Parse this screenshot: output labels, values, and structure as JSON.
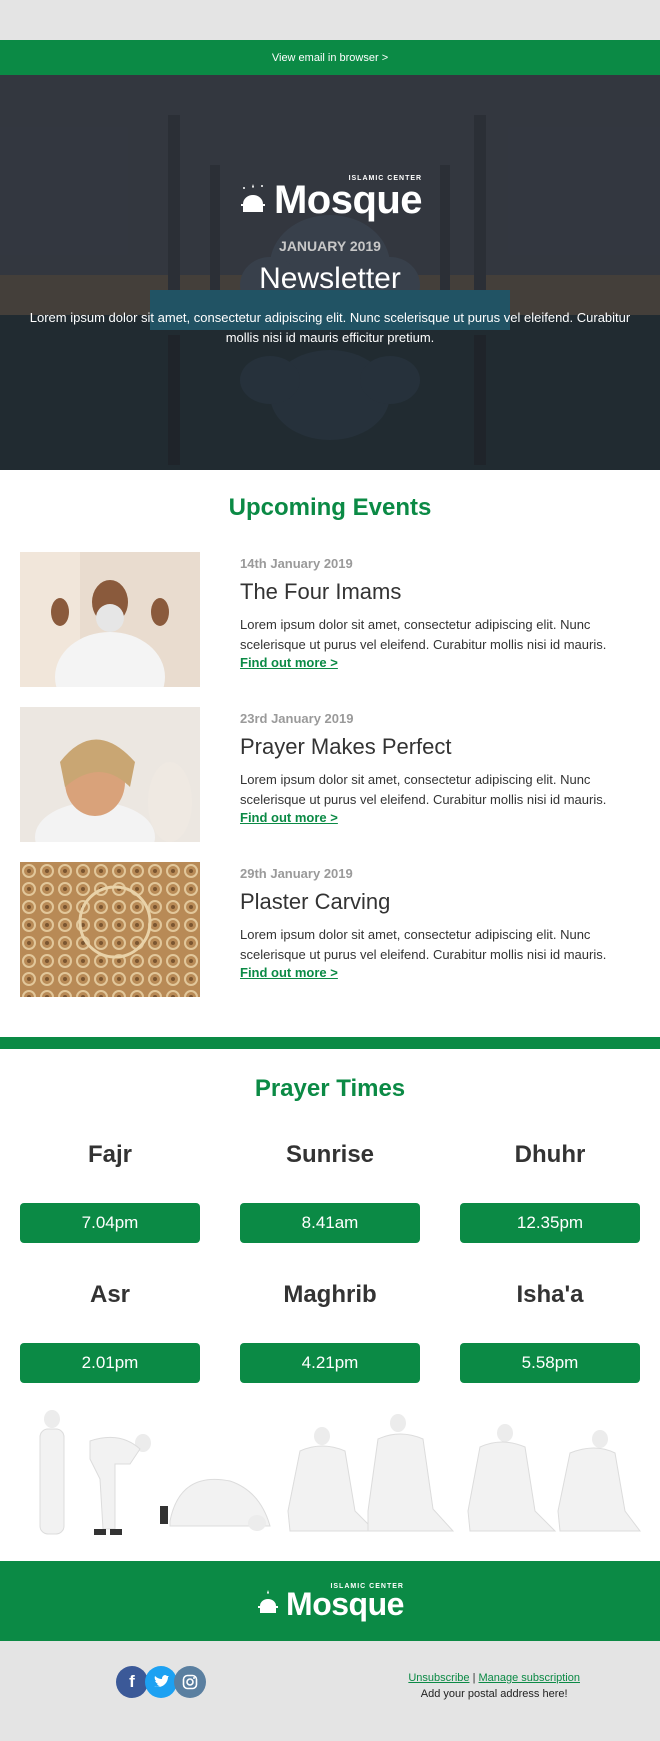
{
  "browser_bar": {
    "label": "View email in browser >"
  },
  "hero": {
    "logo_small": "ISLAMIC CENTER",
    "logo_big": "Mosque",
    "date": "JANUARY 2019",
    "title": "Newsletter",
    "text": "Lorem ipsum dolor sit amet, consectetur adipiscing elit. Nunc scelerisque ut purus vel eleifend. Curabitur mollis nisi id mauris efficitur pretium."
  },
  "events": {
    "title": "Upcoming Events",
    "items": [
      {
        "date": "14th January 2019",
        "title": "The Four Imams",
        "desc": "Lorem ipsum dolor sit amet, consectetur adipiscing elit. Nunc scelerisque ut purus vel eleifend. Curabitur mollis nisi id mauris.",
        "link": "Find out more >"
      },
      {
        "date": "23rd January 2019",
        "title": "Prayer Makes Perfect",
        "desc": "Lorem ipsum dolor sit amet, consectetur adipiscing elit. Nunc scelerisque ut purus vel eleifend. Curabitur mollis nisi id mauris.",
        "link": "Find out more >"
      },
      {
        "date": "29th January 2019",
        "title": "Plaster Carving",
        "desc": "Lorem ipsum dolor sit amet, consectetur adipiscing elit. Nunc scelerisque ut purus vel eleifend. Curabitur mollis nisi id mauris.",
        "link": "Find out more >"
      }
    ]
  },
  "prayer": {
    "title": "Prayer Times",
    "times": [
      {
        "name": "Fajr",
        "time": "7.04pm"
      },
      {
        "name": "Sunrise",
        "time": "8.41am"
      },
      {
        "name": "Dhuhr",
        "time": "12.35pm"
      },
      {
        "name": "Asr",
        "time": "2.01pm"
      },
      {
        "name": "Maghrib",
        "time": "4.21pm"
      },
      {
        "name": "Isha'a",
        "time": "5.58pm"
      }
    ]
  },
  "footer": {
    "logo_small": "ISLAMIC CENTER",
    "logo_big": "Mosque",
    "social": [
      "facebook-icon",
      "twitter-icon",
      "instagram-icon"
    ],
    "unsubscribe": "Unsubscribe",
    "separator": "|",
    "manage": "Manage subscription",
    "address": "Add your postal address here!"
  },
  "colors": {
    "brand_green": "#0b8a45",
    "muted_grey": "#9a9a9a",
    "facebook": "#3b5998",
    "twitter": "#1da1f2",
    "instagram": "#5a7fa0"
  }
}
